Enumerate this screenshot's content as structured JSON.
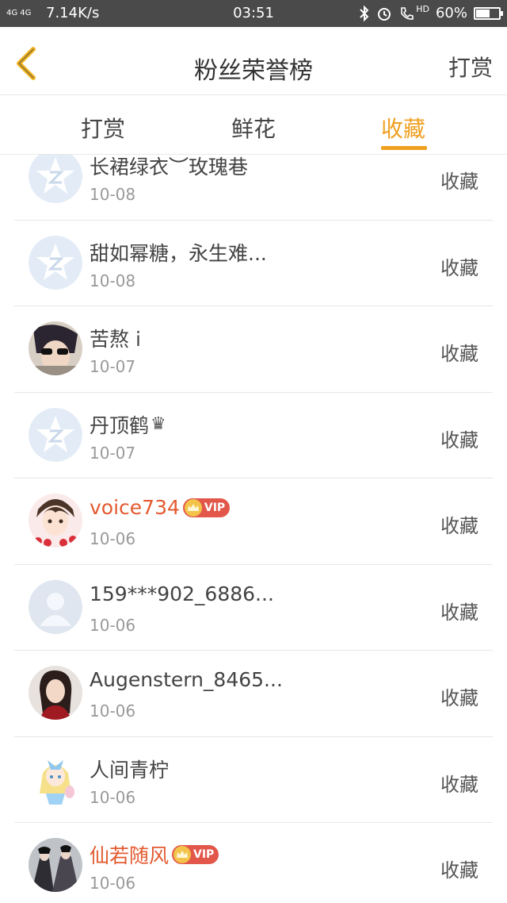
{
  "status_bar": {
    "network": "4G 4G",
    "speed": "7.14K/s",
    "time": "03:51",
    "indicators": "HD",
    "battery_percent": "60%",
    "battery_level": 0.6
  },
  "header": {
    "title": "粉丝荣誉榜",
    "right_action": "打赏"
  },
  "tabs": [
    {
      "label": "打赏",
      "active": false
    },
    {
      "label": "鲜花",
      "active": false
    },
    {
      "label": "收藏",
      "active": true
    }
  ],
  "colors": {
    "accent": "#f0a020",
    "vip_name": "#e35a30",
    "status_bar": "#4a4a4a"
  },
  "list": [
    {
      "name": "长裙绿衣︶玫瑰巷",
      "date": "10-08",
      "action": "收藏",
      "vip": false,
      "avatar": "default-star-avatar"
    },
    {
      "name": "甜如幂糖，永生难...",
      "date": "10-08",
      "action": "收藏",
      "vip": false,
      "avatar": "default-star-avatar"
    },
    {
      "name": "苦熬 i",
      "date": "10-07",
      "action": "收藏",
      "vip": false,
      "avatar": "photo-sunglasses-avatar"
    },
    {
      "name": "丹顶鹤",
      "date": "10-07",
      "action": "收藏",
      "vip": false,
      "avatar": "default-star-avatar",
      "suffix": "♛"
    },
    {
      "name": "voice734",
      "date": "10-06",
      "action": "收藏",
      "vip": true,
      "vip_label": "VIP",
      "avatar": "anime-boy-avatar"
    },
    {
      "name": "159***902_6886...",
      "date": "10-06",
      "action": "收藏",
      "vip": false,
      "avatar": "default-person-avatar"
    },
    {
      "name": "Augenstern_8465...",
      "date": "10-06",
      "action": "收藏",
      "vip": false,
      "avatar": "photo-woman-avatar"
    },
    {
      "name": "人间青柠",
      "date": "10-06",
      "action": "收藏",
      "vip": false,
      "avatar": "cartoon-alice-avatar"
    },
    {
      "name": "仙若随风",
      "date": "10-06",
      "action": "收藏",
      "vip": true,
      "vip_label": "VIP",
      "avatar": "illustration-warriors-avatar"
    }
  ]
}
